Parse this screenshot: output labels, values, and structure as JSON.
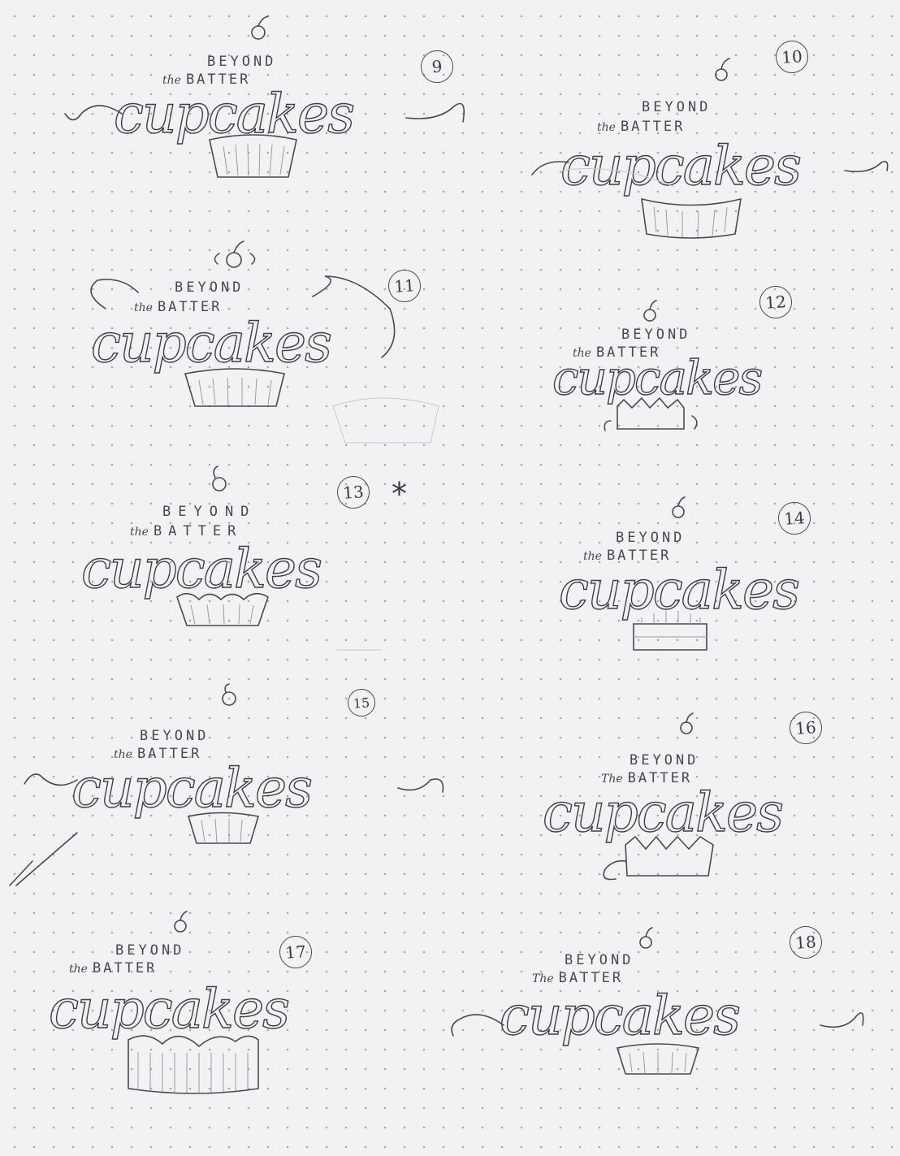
{
  "sketches": [
    {
      "number": "9",
      "line1": "BEYOND",
      "the": "the",
      "line2": "BATTER",
      "word": "cupcakes"
    },
    {
      "number": "10",
      "line1": "BEYOND",
      "the": "the",
      "line2": "BATTER",
      "word": "cupcakes"
    },
    {
      "number": "11",
      "line1": "BEYOND",
      "the": "the",
      "line2": "BATTER",
      "word": "cupcakes"
    },
    {
      "number": "12",
      "line1": "BEYOND",
      "the": "the",
      "line2": "BATTER",
      "word": "cupcakes"
    },
    {
      "number": "13",
      "line1": "BEYOND",
      "the": "the",
      "line2": "BATTER",
      "word": "cupcakes"
    },
    {
      "number": "14",
      "line1": "BEYOND",
      "the": "the",
      "line2": "BATTER",
      "word": "cupcakes"
    },
    {
      "number": "15",
      "line1": "BEYOND",
      "the": "the",
      "line2": "BATTER",
      "word": "cupcakes"
    },
    {
      "number": "16",
      "line1": "BEYOND",
      "the": "The",
      "line2": "BATTER",
      "word": "cupcakes"
    },
    {
      "number": "17",
      "line1": "BEYOND",
      "the": "the",
      "line2": "BATTER",
      "word": "cupcakes"
    },
    {
      "number": "18",
      "line1": "BEYOND",
      "the": "The",
      "line2": "BATTER",
      "word": "cupcakes"
    }
  ],
  "star_mark": "*",
  "colors": {
    "paper": "#f2f1f3",
    "dots": "#a9a8ad",
    "pencil": "#3e3e43"
  },
  "icons": [
    "cherry-icon",
    "cupcake-liner-icon",
    "swash-flourish"
  ]
}
